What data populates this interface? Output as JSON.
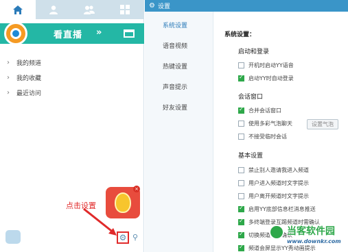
{
  "left_panel": {
    "tabs": [
      {
        "icon": "home-icon",
        "active": true
      },
      {
        "icon": "person-icon",
        "active": false
      },
      {
        "icon": "people-icon",
        "active": false
      },
      {
        "icon": "grid-icon",
        "active": false
      }
    ],
    "banner": {
      "label": "看直播",
      "chevron": "»"
    },
    "nav_items": [
      {
        "label": "我的频道"
      },
      {
        "label": "我的收藏"
      },
      {
        "label": "最近访问"
      }
    ],
    "annotation": "点击设置",
    "gift_close": "×",
    "colors": {
      "banner": "#24b7a5",
      "annotation": "#e02a2a",
      "tabbar": "#cfe0ea"
    }
  },
  "settings_window": {
    "title": "设置",
    "sidebar": [
      {
        "label": "系统设置",
        "active": true
      },
      {
        "label": "语音视频",
        "active": false
      },
      {
        "label": "热键设置",
        "active": false
      },
      {
        "label": "声音提示",
        "active": false
      },
      {
        "label": "好友设置",
        "active": false
      }
    ],
    "main_heading": "系统设置：",
    "groups": [
      {
        "title": "启动和登录",
        "options": [
          {
            "label": "开机时启动YY语音",
            "checked": false
          },
          {
            "label": "启动YY时自动登录",
            "checked": true
          }
        ]
      },
      {
        "title": "会话窗口",
        "options": [
          {
            "label": "合并会话窗口",
            "checked": true
          },
          {
            "label": "使用多彩气泡聊天",
            "checked": false
          },
          {
            "label": "不接受临时会话",
            "checked": false
          }
        ],
        "bubble_button": "设置气泡"
      },
      {
        "title": "基本设置",
        "options": [
          {
            "label": "禁止别人邀请我进入频道",
            "checked": false
          },
          {
            "label": "用户进入频道时文字提示",
            "checked": false
          },
          {
            "label": "用户离开频道时文字提示",
            "checked": false
          },
          {
            "label": "启用YY底部信息栏消息推送",
            "checked": true
          },
          {
            "label": "多终端登录互踢频道时需确认",
            "checked": true
          },
          {
            "label": "切换频道时需确认",
            "checked": true
          },
          {
            "label": "频道会屏显示YY秀动画提示",
            "checked": true
          }
        ]
      }
    ],
    "colors": {
      "titlebar": "#3a95c8",
      "check_on": "#2ea84a",
      "active_nav": "#2b7bb9"
    }
  },
  "watermark": {
    "title": "当客软件园",
    "url": "www.downkr.com"
  }
}
